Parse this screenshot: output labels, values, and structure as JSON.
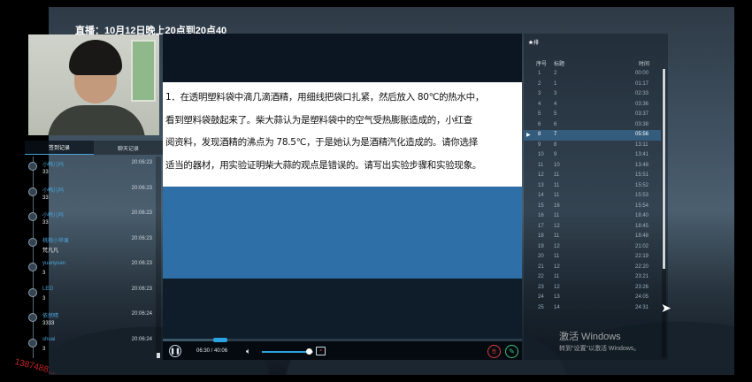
{
  "header": {
    "schedule": "直播：10月12日晚上20点到20点40"
  },
  "left_tabs": [
    "签到记录",
    "聊天记录"
  ],
  "checkins": [
    {
      "name": "小韩儿吗",
      "time": "20:06:23",
      "value": "33"
    },
    {
      "name": "小韩儿吗",
      "time": "20:06:23",
      "value": "33"
    },
    {
      "name": "小韩儿吗",
      "time": "20:06:23",
      "value": "33"
    },
    {
      "name": "桃桃小苹果",
      "time": "20:06:23",
      "value": "梵凡凡"
    },
    {
      "name": "yuanyuan",
      "time": "20:06:23",
      "value": "3"
    },
    {
      "name": "LEO",
      "time": "20:06:23",
      "value": "3"
    },
    {
      "name": "依然晴",
      "time": "20:06:24",
      "value": "3333"
    },
    {
      "name": "shuai",
      "time": "20:06:24",
      "value": "3"
    }
  ],
  "question": {
    "lines": [
      "1．在透明塑料袋中滴几滴酒精，用细线把袋口扎紧，然后放入 80℃的热水中，",
      "看到塑料袋鼓起来了。柴大蒜认为是塑料袋中的空气受热膨胀造成的，小红查",
      "阅资料，发现酒精的沸点为 78.5℃，于是她认为是酒精汽化造成的。请你选择",
      "适当的器材，用实验证明柴大蒜的观点是错误的。请写出实验步骤和实验现象。"
    ]
  },
  "player": {
    "play_icon": "pause-icon",
    "time": "06:30 / 40:06",
    "progress": 0.16,
    "volume": 0.92
  },
  "right_panel": {
    "header": "★排",
    "columns": {
      "seq": "序号",
      "label": "标题",
      "time": "时间"
    },
    "active_index": 6,
    "active_marker": "▶",
    "rows": [
      {
        "seq": "1",
        "label": "2",
        "time": "00:00"
      },
      {
        "seq": "2",
        "label": "1",
        "time": "01:17"
      },
      {
        "seq": "3",
        "label": "3",
        "time": "02:33"
      },
      {
        "seq": "4",
        "label": "4",
        "time": "03:36"
      },
      {
        "seq": "5",
        "label": "5",
        "time": "03:37"
      },
      {
        "seq": "6",
        "label": "6",
        "time": "03:38"
      },
      {
        "seq": "8",
        "label": "7",
        "time": "05:56"
      },
      {
        "seq": "9",
        "label": "8",
        "time": "13:11"
      },
      {
        "seq": "10",
        "label": "9",
        "time": "13:41"
      },
      {
        "seq": "11",
        "label": "10",
        "time": "13:48"
      },
      {
        "seq": "12",
        "label": "11",
        "time": "15:51"
      },
      {
        "seq": "13",
        "label": "11",
        "time": "15:52"
      },
      {
        "seq": "14",
        "label": "11",
        "time": "15:53"
      },
      {
        "seq": "15",
        "label": "16",
        "time": "15:54"
      },
      {
        "seq": "16",
        "label": "11",
        "time": "18:40"
      },
      {
        "seq": "17",
        "label": "12",
        "time": "18:45"
      },
      {
        "seq": "18",
        "label": "11",
        "time": "18:48"
      },
      {
        "seq": "19",
        "label": "12",
        "time": "21:02"
      },
      {
        "seq": "20",
        "label": "11",
        "time": "22:19"
      },
      {
        "seq": "21",
        "label": "12",
        "time": "22:20"
      },
      {
        "seq": "22",
        "label": "11",
        "time": "23:21"
      },
      {
        "seq": "23",
        "label": "12",
        "time": "23:26"
      },
      {
        "seq": "24",
        "label": "13",
        "time": "24:05"
      },
      {
        "seq": "25",
        "label": "14",
        "time": "24:31"
      }
    ]
  },
  "overlay": {
    "windows_activate": "激活 Windows",
    "windows_hint": "转到\"设置\"以激活 Windows。",
    "phone_watermark": "1387488..."
  }
}
